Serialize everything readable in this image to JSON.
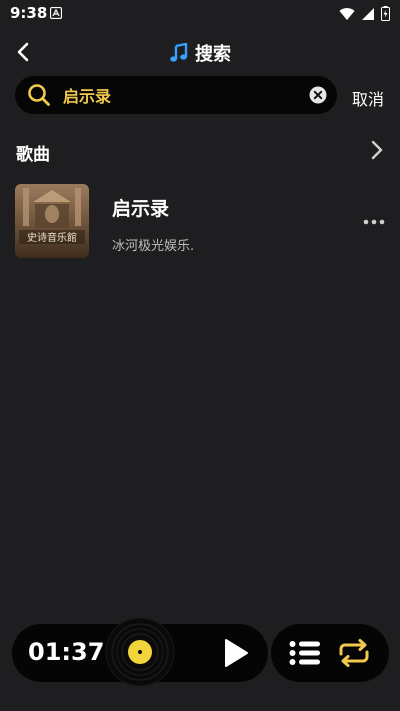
{
  "status_bar": {
    "time": "9:38"
  },
  "header": {
    "title": "搜索"
  },
  "search": {
    "query": "启示录",
    "cancel_label": "取消"
  },
  "songs_section": {
    "title": "歌曲"
  },
  "results": [
    {
      "title": "启示录",
      "artist": "冰河极光娱乐.",
      "cover_text": "史诗音乐館"
    }
  ],
  "player": {
    "time": "01:37"
  },
  "colors": {
    "accent": "#f2c94c",
    "background": "#1e1e20",
    "bar": "#050505",
    "music_icon": "#3aa0ff"
  }
}
